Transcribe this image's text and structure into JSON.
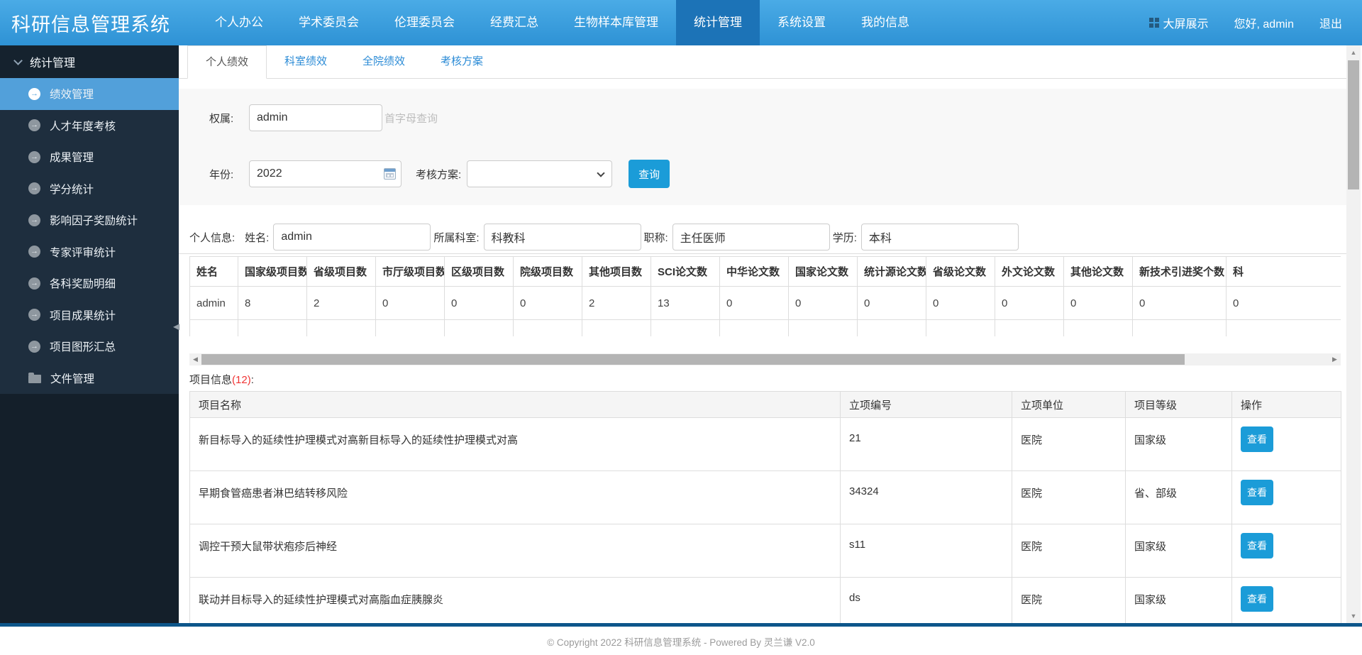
{
  "app": {
    "title": "科研信息管理系统"
  },
  "topnav": {
    "items": [
      {
        "label": "个人办公",
        "active": false
      },
      {
        "label": "学术委员会",
        "active": false
      },
      {
        "label": "伦理委员会",
        "active": false
      },
      {
        "label": "经费汇总",
        "active": false
      },
      {
        "label": "生物样本库管理",
        "active": false
      },
      {
        "label": "统计管理",
        "active": true
      },
      {
        "label": "系统设置",
        "active": false
      },
      {
        "label": "我的信息",
        "active": false
      }
    ],
    "right": {
      "screen_label": "大屏展示",
      "greeting": "您好, admin",
      "logout_label": "退出"
    }
  },
  "sidebar": {
    "group_label": "统计管理",
    "items": [
      {
        "label": "绩效管理",
        "active": true,
        "icon": "circle-arrow"
      },
      {
        "label": "人才年度考核",
        "active": false,
        "icon": "circle-arrow"
      },
      {
        "label": "成果管理",
        "active": false,
        "icon": "circle-arrow"
      },
      {
        "label": "学分统计",
        "active": false,
        "icon": "circle-arrow"
      },
      {
        "label": "影响因子奖励统计",
        "active": false,
        "icon": "circle-arrow"
      },
      {
        "label": "专家评审统计",
        "active": false,
        "icon": "circle-arrow"
      },
      {
        "label": "各科奖励明细",
        "active": false,
        "icon": "circle-arrow"
      },
      {
        "label": "项目成果统计",
        "active": false,
        "icon": "circle-arrow"
      },
      {
        "label": "项目图形汇总",
        "active": false,
        "icon": "circle-arrow"
      },
      {
        "label": "文件管理",
        "active": false,
        "icon": "folder"
      }
    ]
  },
  "tabs": [
    {
      "label": "个人绩效",
      "active": true
    },
    {
      "label": "科室绩效",
      "active": false
    },
    {
      "label": "全院绩效",
      "active": false
    },
    {
      "label": "考核方案",
      "active": false
    }
  ],
  "query": {
    "owner_label": "权属:",
    "owner_value": "admin",
    "initial_hint": "首字母查询",
    "year_label": "年份:",
    "year_value": "2022",
    "plan_label": "考核方案:",
    "plan_value": "",
    "search_button": "查询"
  },
  "personal": {
    "section_label": "个人信息:",
    "fields": [
      {
        "label": "姓名:",
        "value": "admin"
      },
      {
        "label": "所属科室:",
        "value": "科教科"
      },
      {
        "label": "职称:",
        "value": "主任医师"
      },
      {
        "label": "学历:",
        "value": "本科"
      }
    ]
  },
  "stats_table": {
    "columns": [
      "姓名",
      "国家级项目数",
      "省级项目数",
      "市厅级项目数",
      "区级项目数",
      "院级项目数",
      "其他项目数",
      "SCI论文数",
      "中华论文数",
      "国家论文数",
      "统计源论文数",
      "省级论文数",
      "外文论文数",
      "其他论文数",
      "新技术引进奖个数",
      "科"
    ],
    "row": [
      "admin",
      "8",
      "2",
      "0",
      "0",
      "0",
      "2",
      "13",
      "0",
      "0",
      "0",
      "0",
      "0",
      "0",
      "0",
      "0"
    ]
  },
  "projects": {
    "section_label": "项目信息",
    "count_display": "(12)",
    "suffix": ":",
    "columns": [
      "项目名称",
      "立项编号",
      "立项单位",
      "项目等级",
      "操作"
    ],
    "action_label": "查看",
    "rows": [
      {
        "name": "新目标导入的延续性护理模式对高新目标导入的延续性护理模式对高",
        "code": "21",
        "unit": "医院",
        "grade": "国家级"
      },
      {
        "name": "早期食管癌患者淋巴结转移风险",
        "code": "34324",
        "unit": "医院",
        "grade": "省、部级"
      },
      {
        "name": "调控干预大鼠带状疱疹后神经",
        "code": "s11",
        "unit": "医院",
        "grade": "国家级"
      },
      {
        "name": "联动并目标导入的延续性护理模式对高脂血症胰腺炎",
        "code": "ds",
        "unit": "医院",
        "grade": "国家级"
      }
    ]
  },
  "footer": {
    "text": "© Copyright 2022 科研信息管理系统 - Powered By 灵兰谦 V2.0"
  },
  "colors": {
    "accent": "#1b9cd8",
    "nav_active": "#1c73b7",
    "sidebar_active": "#52a0da",
    "count_red": "#f03333",
    "bottom_bar": "#0d568a"
  }
}
